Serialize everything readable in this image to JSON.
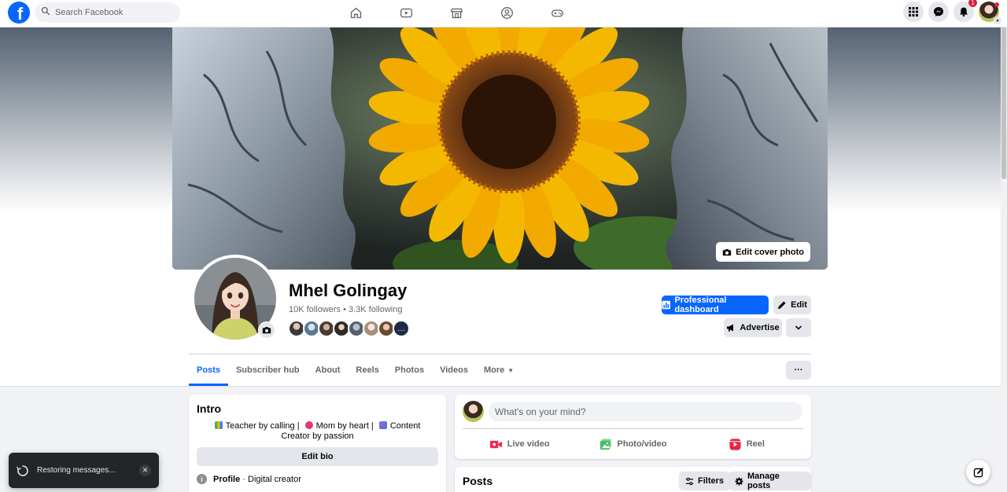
{
  "topbar": {
    "logo_letter": "f",
    "search_placeholder": "Search Facebook",
    "nav_icons": [
      "home-icon",
      "video-icon",
      "marketplace-icon",
      "groups-icon",
      "gaming-icon"
    ],
    "notification_count": "1"
  },
  "cover": {
    "edit_cover_label": "Edit cover photo"
  },
  "profile": {
    "name": "Mhel Golingay",
    "stats": "10K followers • 3.3K following",
    "more_followers_glyph": "…",
    "buttons": {
      "dashboard_label": "Professional dashboard",
      "edit_label": "Edit",
      "advertise_label": "Advertise"
    }
  },
  "tabs": [
    {
      "label": "Posts",
      "active": true
    },
    {
      "label": "Subscriber hub"
    },
    {
      "label": "About"
    },
    {
      "label": "Reels"
    },
    {
      "label": "Photos"
    },
    {
      "label": "Videos"
    },
    {
      "label": "More"
    }
  ],
  "tabs_more_glyph": "···",
  "intro": {
    "title": "Intro",
    "bio_line1_a": "Teacher by calling |",
    "bio_line1_b": "Mom by heart |",
    "bio_line1_c": "Content Creator by passion",
    "edit_bio_label": "Edit bio",
    "profile_label": "Profile",
    "profile_category": "· Digital creator"
  },
  "composer": {
    "placeholder": "What's on your mind?",
    "actions": [
      "Live video",
      "Photo/video",
      "Reel"
    ]
  },
  "posts": {
    "title": "Posts",
    "filters_label": "Filters",
    "manage_label": "Manage posts"
  },
  "toast": {
    "text": "Restoring messages...",
    "close_glyph": "✕"
  },
  "colors": {
    "brand_blue": "#0866ff",
    "badge_red": "#e41e3f",
    "sunflower_yellow": "#f5b800"
  }
}
